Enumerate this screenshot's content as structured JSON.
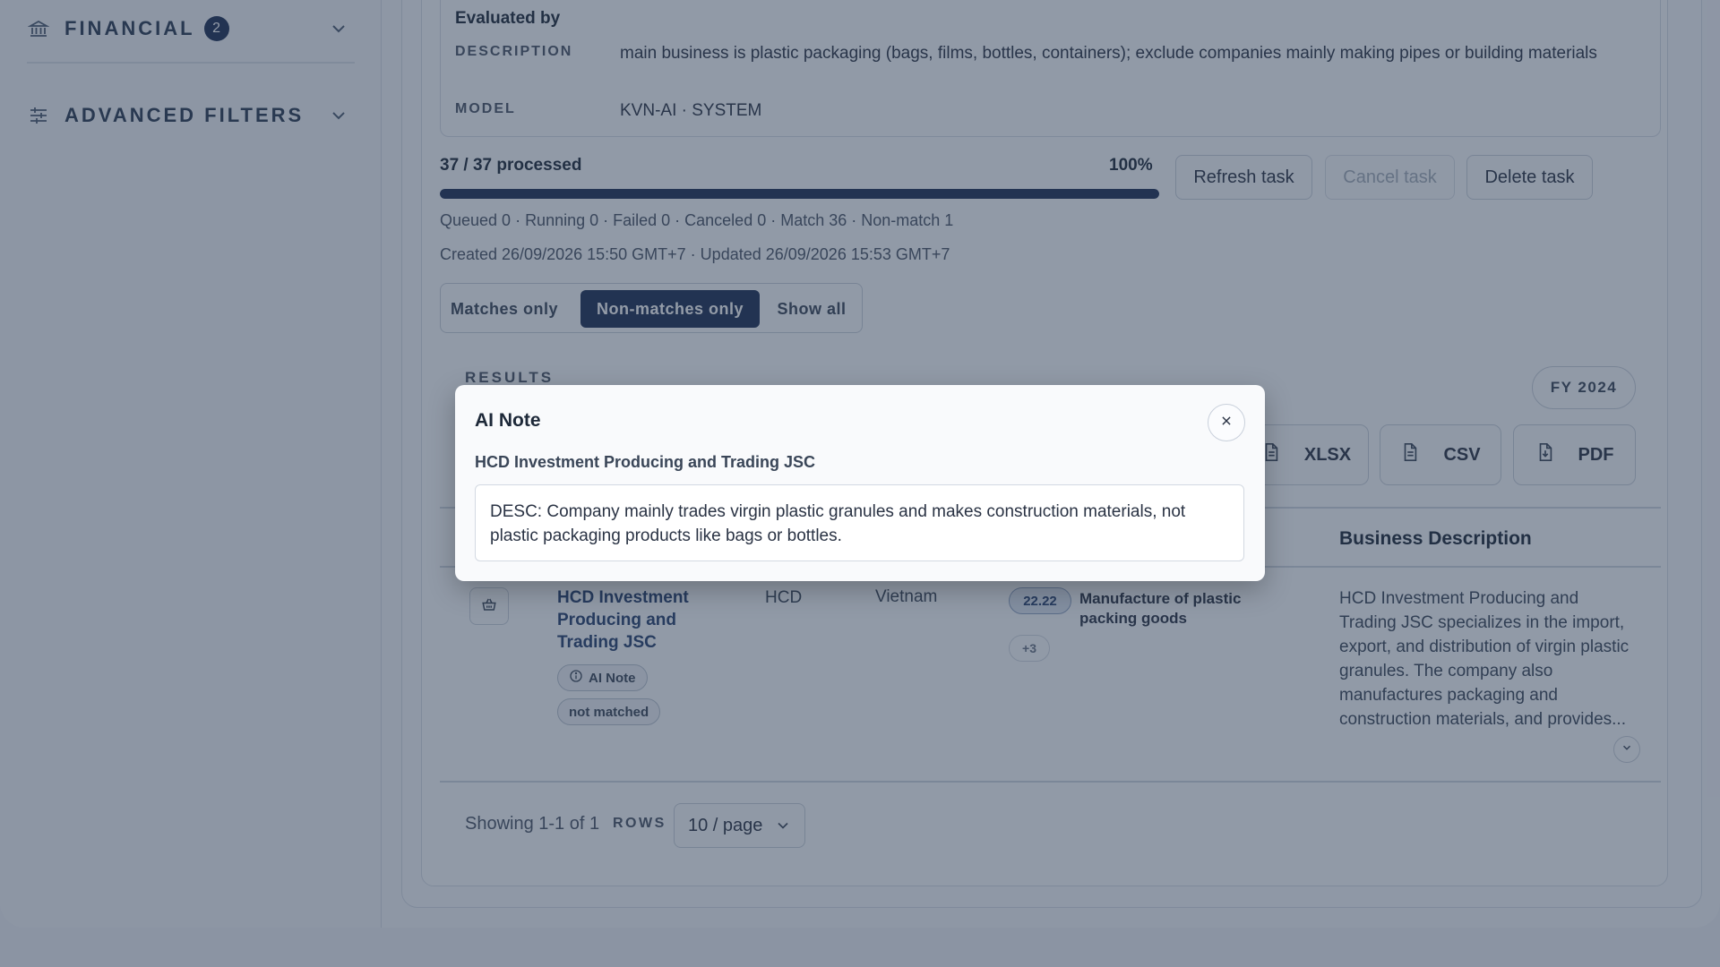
{
  "sidebar": {
    "sections": [
      {
        "label": "FINANCIAL",
        "badge": "2",
        "icon": "bank-icon"
      },
      {
        "label": "ADVANCED FILTERS",
        "icon": "sliders-icon"
      }
    ]
  },
  "evaluation": {
    "title": "Evaluated by",
    "description_key": "DESCRIPTION",
    "description_value": "main business is plastic packaging (bags, films, bottles, containers); exclude companies mainly making pipes or building materials",
    "model_key": "MODEL",
    "model_value": "KVN-AI · SYSTEM"
  },
  "progress": {
    "label": "37 / 37 processed",
    "percent_text": "100%",
    "fraction": 1.0
  },
  "task_buttons": {
    "refresh": "Refresh task",
    "cancel": "Cancel task",
    "delete": "Delete task"
  },
  "stats": {
    "counts": "Queued 0 · Running 0 · Failed 0 · Canceled 0 · Match 36 · Non-match 1",
    "dates": "Created 26/09/2026 15:50 GMT+7 · Updated 26/09/2026 15:53 GMT+7"
  },
  "filter_segment": {
    "options": [
      "Matches only",
      "Non-matches only",
      "Show all"
    ],
    "selected": "Non-matches only"
  },
  "results": {
    "label": "RESULTS",
    "fiscal_year": "FY 2024",
    "export": {
      "xlsx": "XLSX",
      "csv": "CSV",
      "pdf": "PDF"
    },
    "columns": {
      "business_description": "Business Description"
    },
    "rows": [
      {
        "company": "HCD Investment Producing and Trading JSC",
        "ai_note_tag": "AI Note",
        "status_tag": "not matched",
        "ticker": "HCD",
        "country": "Vietnam",
        "industry_code": "22.22",
        "industry": "Manufacture of plastic packing goods",
        "more_industries": "+3",
        "business_description": "HCD Investment Producing and Trading JSC specializes in the import, export, and distribution of virgin plastic granules. The company also manufactures packaging and construction materials, and provides..."
      }
    ]
  },
  "pagination": {
    "showing": "Showing 1-1 of 1",
    "rows_label": "ROWS",
    "page_size": "10 / page"
  },
  "modal": {
    "title": "AI Note",
    "company": "HCD Investment Producing and Trading JSC",
    "note": "DESC: Company mainly trades virgin plastic granules and makes construction materials, not plastic packaging products like bags or bottles."
  }
}
